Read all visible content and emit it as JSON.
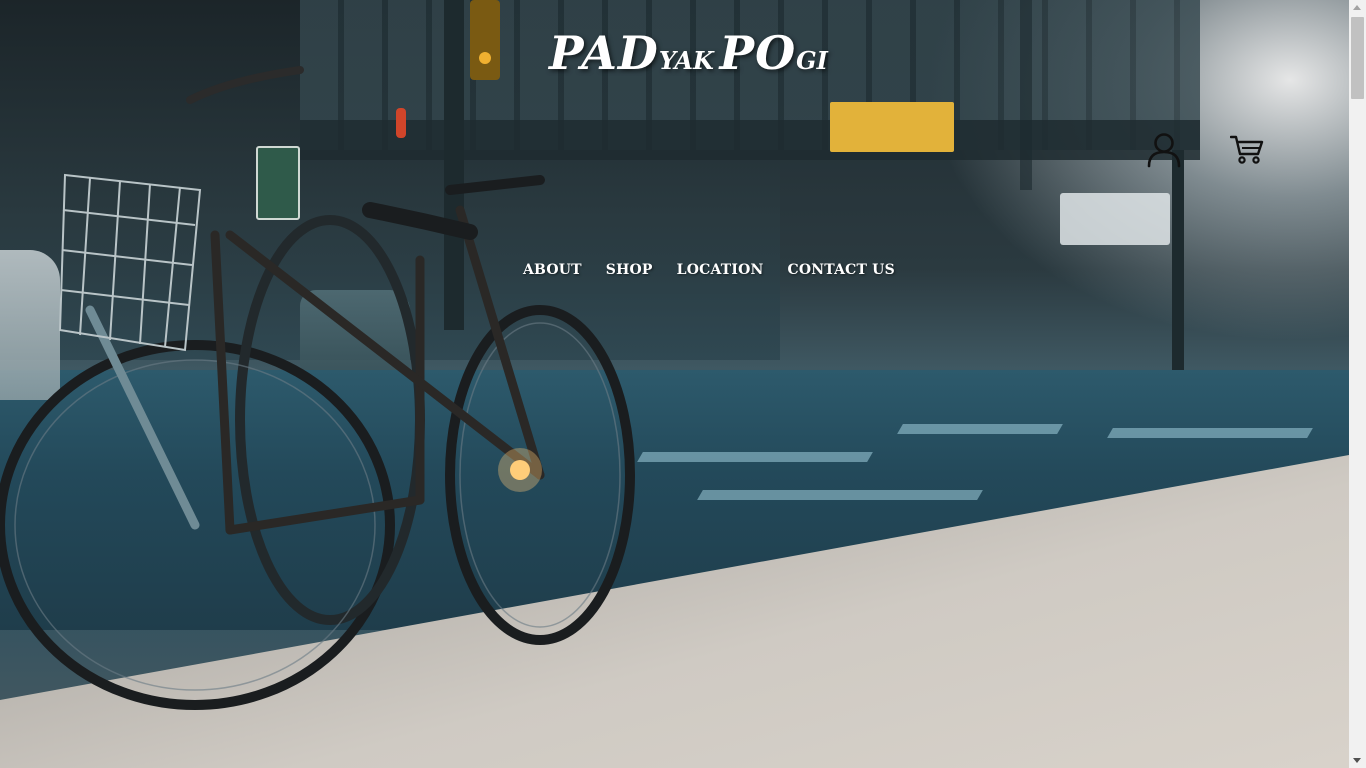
{
  "brand": {
    "part1_big": "PAD",
    "part1_small": "YAK",
    "part2_big": "PO",
    "part2_small": "GI"
  },
  "header": {
    "account_icon": "user-icon",
    "cart_icon": "shopping-cart-icon"
  },
  "nav": {
    "items": [
      {
        "label": "ABOUT"
      },
      {
        "label": "SHOP"
      },
      {
        "label": "LOCATION"
      },
      {
        "label": "CONTACT US"
      }
    ]
  },
  "hero": {
    "image_subject": "bicycles-on-city-street"
  },
  "colors": {
    "nav_text": "#ffffff",
    "logo_text": "#ffffff",
    "icon_stroke": "#111111"
  }
}
